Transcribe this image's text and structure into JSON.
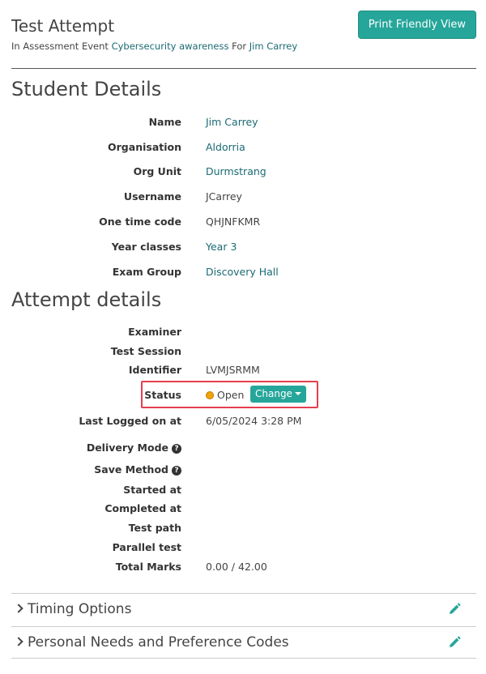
{
  "header": {
    "title": "Test Attempt",
    "subtitle_prefix": "In Assessment Event",
    "event_link": "Cybersecurity awareness",
    "subtitle_for": "For",
    "student_link": "Jim Carrey",
    "print_button": "Print Friendly View"
  },
  "student_details": {
    "title": "Student Details",
    "rows": [
      {
        "label": "Name",
        "value": "Jim Carrey"
      },
      {
        "label": "Organisation",
        "value": "Aldorria"
      },
      {
        "label": "Org Unit",
        "value": "Durmstrang"
      },
      {
        "label": "Username",
        "value": "JCarrey"
      },
      {
        "label": "One time code",
        "value": "QHJNFKMR"
      },
      {
        "label": "Year classes",
        "value": "Year 3"
      },
      {
        "label": "Exam Group",
        "value": "Discovery Hall"
      }
    ]
  },
  "attempt_details": {
    "title": "Attempt details",
    "examiner_label": "Examiner",
    "test_session_label": "Test Session",
    "identifier_label": "Identifier",
    "identifier_value": "LVMJSRMM",
    "status_label": "Status",
    "status_value": "Open",
    "status_color": "#f0a30a",
    "change_button": "Change",
    "last_logged_label": "Last Logged on at",
    "last_logged_value": "6/05/2024 3:28 PM",
    "delivery_mode_label": "Delivery Mode",
    "save_method_label": "Save Method",
    "started_label": "Started at",
    "completed_label": "Completed at",
    "test_path_label": "Test path",
    "parallel_test_label": "Parallel test",
    "total_marks_label": "Total Marks",
    "total_marks_value": "0.00 / 42.00"
  },
  "accordions": [
    {
      "label": "Timing Options",
      "icon": "pencil-icon"
    },
    {
      "label": "Personal Needs and Preference Codes",
      "icon": "pencil-icon"
    }
  ],
  "colors": {
    "accent": "#26a69a",
    "link": "#1a6a73",
    "highlight_border": "#e53e4f"
  }
}
